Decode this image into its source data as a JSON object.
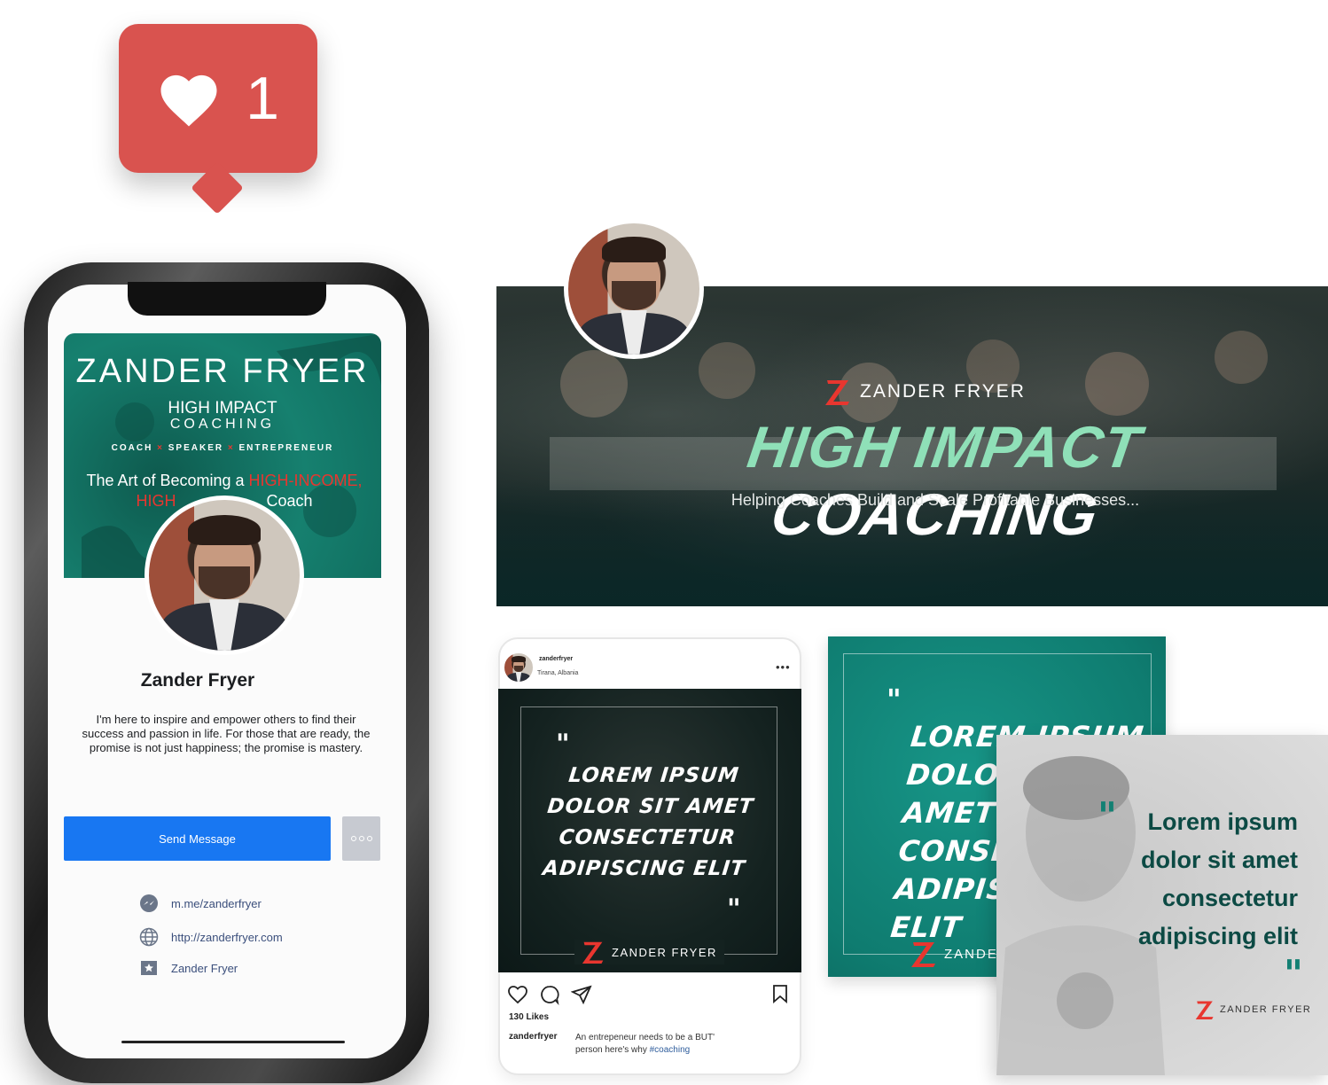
{
  "like_notification": {
    "count": "1",
    "color": "#d9534f",
    "icon": "heart-icon"
  },
  "facebook_profile": {
    "cover": {
      "title": "ZANDER FRYER",
      "program_line1": "HIGH IMPACT",
      "program_line2": "COACHING",
      "roles": [
        "COACH",
        "SPEAKER",
        "ENTREPRENEUR"
      ],
      "tagline_prefix": "The Art of Becoming a ",
      "tagline_highlight": "HIGH-INCOME,",
      "tagline_line2_highlight": "HIGH",
      "tagline_line2_suffix": "Coach"
    },
    "name": "Zander Fryer",
    "bio": "I'm here to inspire and empower others to find their success and passion in life. For those that are ready, the promise is not just happiness; the promise is mastery.",
    "send_button": "Send Message",
    "links": [
      {
        "icon": "messenger-icon",
        "text": "m.me/zanderfryer"
      },
      {
        "icon": "globe-icon",
        "text": "http://zanderfryer.com"
      },
      {
        "icon": "star-page-icon",
        "text": "Zander Fryer"
      }
    ]
  },
  "banner": {
    "brand": "ZANDER FRYER",
    "title_highlight": "HIGH IMPACT",
    "title_rest": "COACHING",
    "subtitle": "Helping Coaches Build and Scale Profitable Businesses..."
  },
  "instagram_post": {
    "username": "zanderfryer",
    "location": "Tirana, Albania",
    "quote": "LOREM IPSUM DOLOR SIT AMET CONSECTETUR ADIPISCING ELIT",
    "brand": "ZANDER FRYER",
    "likes": "130 Likes",
    "caption_user": "zanderfryer",
    "caption_text": "An entrepeneur needs to be a BUT' person here's why ",
    "caption_tag": "#coaching"
  },
  "teal_quote_card": {
    "quote": "LOREM IPSUM DOLOR SIT AMET CONSECTETUR ADIPISCING ELIT",
    "brand": "ZANDER FRYER"
  },
  "gray_quote_card": {
    "quote": "Lorem ipsum dolor sit amet consectetur adipiscing elit",
    "brand": "ZANDER FRYER"
  },
  "colors": {
    "accent_red": "#e8362f",
    "teal": "#0f7c70",
    "facebook_blue": "#1877f2",
    "dark_teal": "#0c4a44"
  }
}
